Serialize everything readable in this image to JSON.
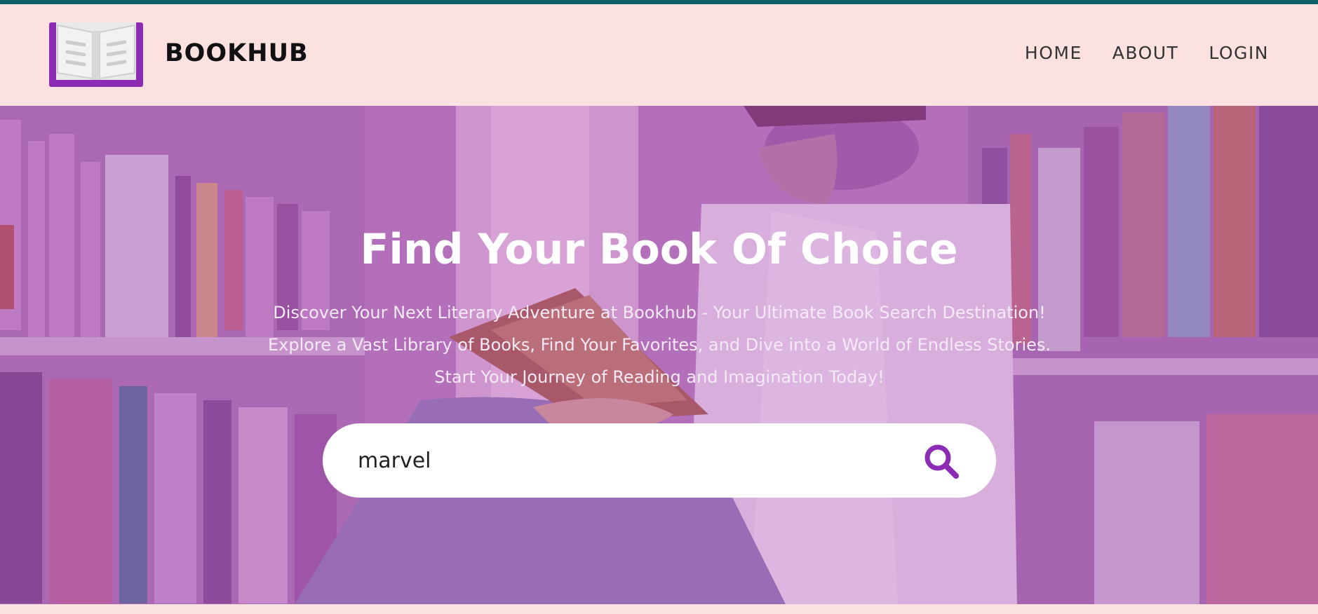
{
  "brand": {
    "name": "BOOKHUB",
    "logo_icon": "open-book-icon"
  },
  "nav": {
    "home": "HOME",
    "about": "ABOUT",
    "login": "LOGIN"
  },
  "hero": {
    "title": "Find Your Book Of Choice",
    "subtitle": "Discover Your Next Literary Adventure at Bookhub - Your Ultimate Book Search Destination! Explore a Vast Library of Books, Find Your Favorites, and Dive into a World of Endless Stories. Start Your Journey of Reading and Imagination Today!",
    "background_image": "person-reading-in-library"
  },
  "search": {
    "value": "marvel",
    "icon": "search-icon"
  },
  "colors": {
    "accent": "#8c2bb4",
    "header_bg": "#fbe1e0",
    "top_strip": "#0e5e66"
  }
}
